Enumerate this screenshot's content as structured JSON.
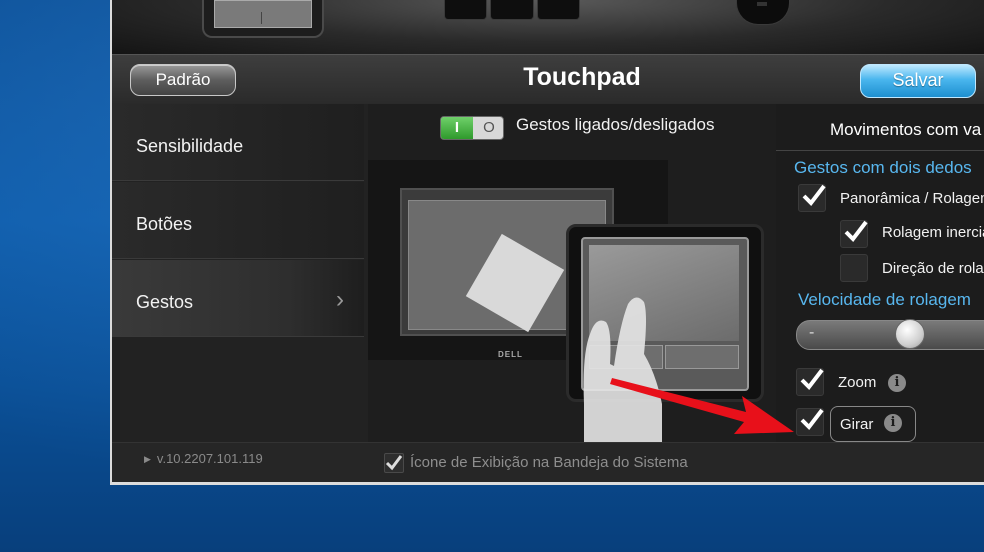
{
  "window": {
    "title": "Touchpad",
    "reset_button": "Padrão",
    "save_button": "Salvar",
    "version": "v.10.2207.101.119"
  },
  "sidebar": {
    "items": [
      {
        "label": "Sensibilidade",
        "active": false
      },
      {
        "label": "Botões",
        "active": false
      },
      {
        "label": "Gestos",
        "active": true
      }
    ]
  },
  "gestures": {
    "toggle_on": "I",
    "toggle_off": "O",
    "toggle_label": "Gestos ligados/desligados",
    "laptop_brand": "DELL"
  },
  "settings": {
    "heading": "Movimentos com va",
    "two_finger_section": "Gestos com dois dedos",
    "pan_scroll": {
      "label": "Panorâmica / Rolagem",
      "checked": true
    },
    "inertial_scroll": {
      "label": "Rolagem inercia",
      "checked": true
    },
    "scroll_direction": {
      "label": "Direção de rola",
      "checked": false
    },
    "scroll_speed_label": "Velocidade de rolagem",
    "scroll_speed_minus": "-",
    "zoom": {
      "label": "Zoom",
      "checked": true,
      "info": "i"
    },
    "rotate": {
      "label": "Girar",
      "checked": true,
      "info": "i"
    }
  },
  "footer": {
    "tray_icon_label": "Ícone de Exibição na Bandeja do Sistema",
    "tray_icon_checked": true
  },
  "colors": {
    "accent_blue": "#58b7ef",
    "toggle_green": "#2f9a2c",
    "annotation_red": "#e8101a"
  }
}
